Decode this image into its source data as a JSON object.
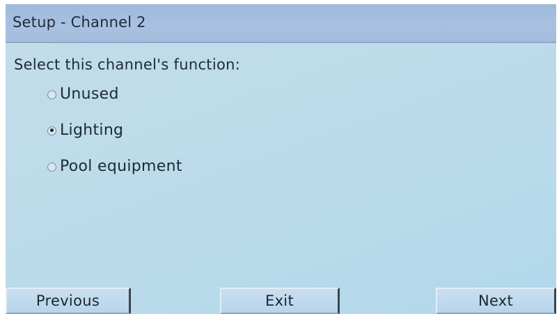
{
  "window": {
    "title": "Setup - Channel 2"
  },
  "prompt": "Select this channel's function:",
  "options": [
    {
      "label": "Unused",
      "checked": false
    },
    {
      "label": "Lighting",
      "checked": true
    },
    {
      "label": "Pool equipment",
      "checked": false
    }
  ],
  "buttons": {
    "previous": "Previous",
    "exit": "Exit",
    "next": "Next"
  }
}
